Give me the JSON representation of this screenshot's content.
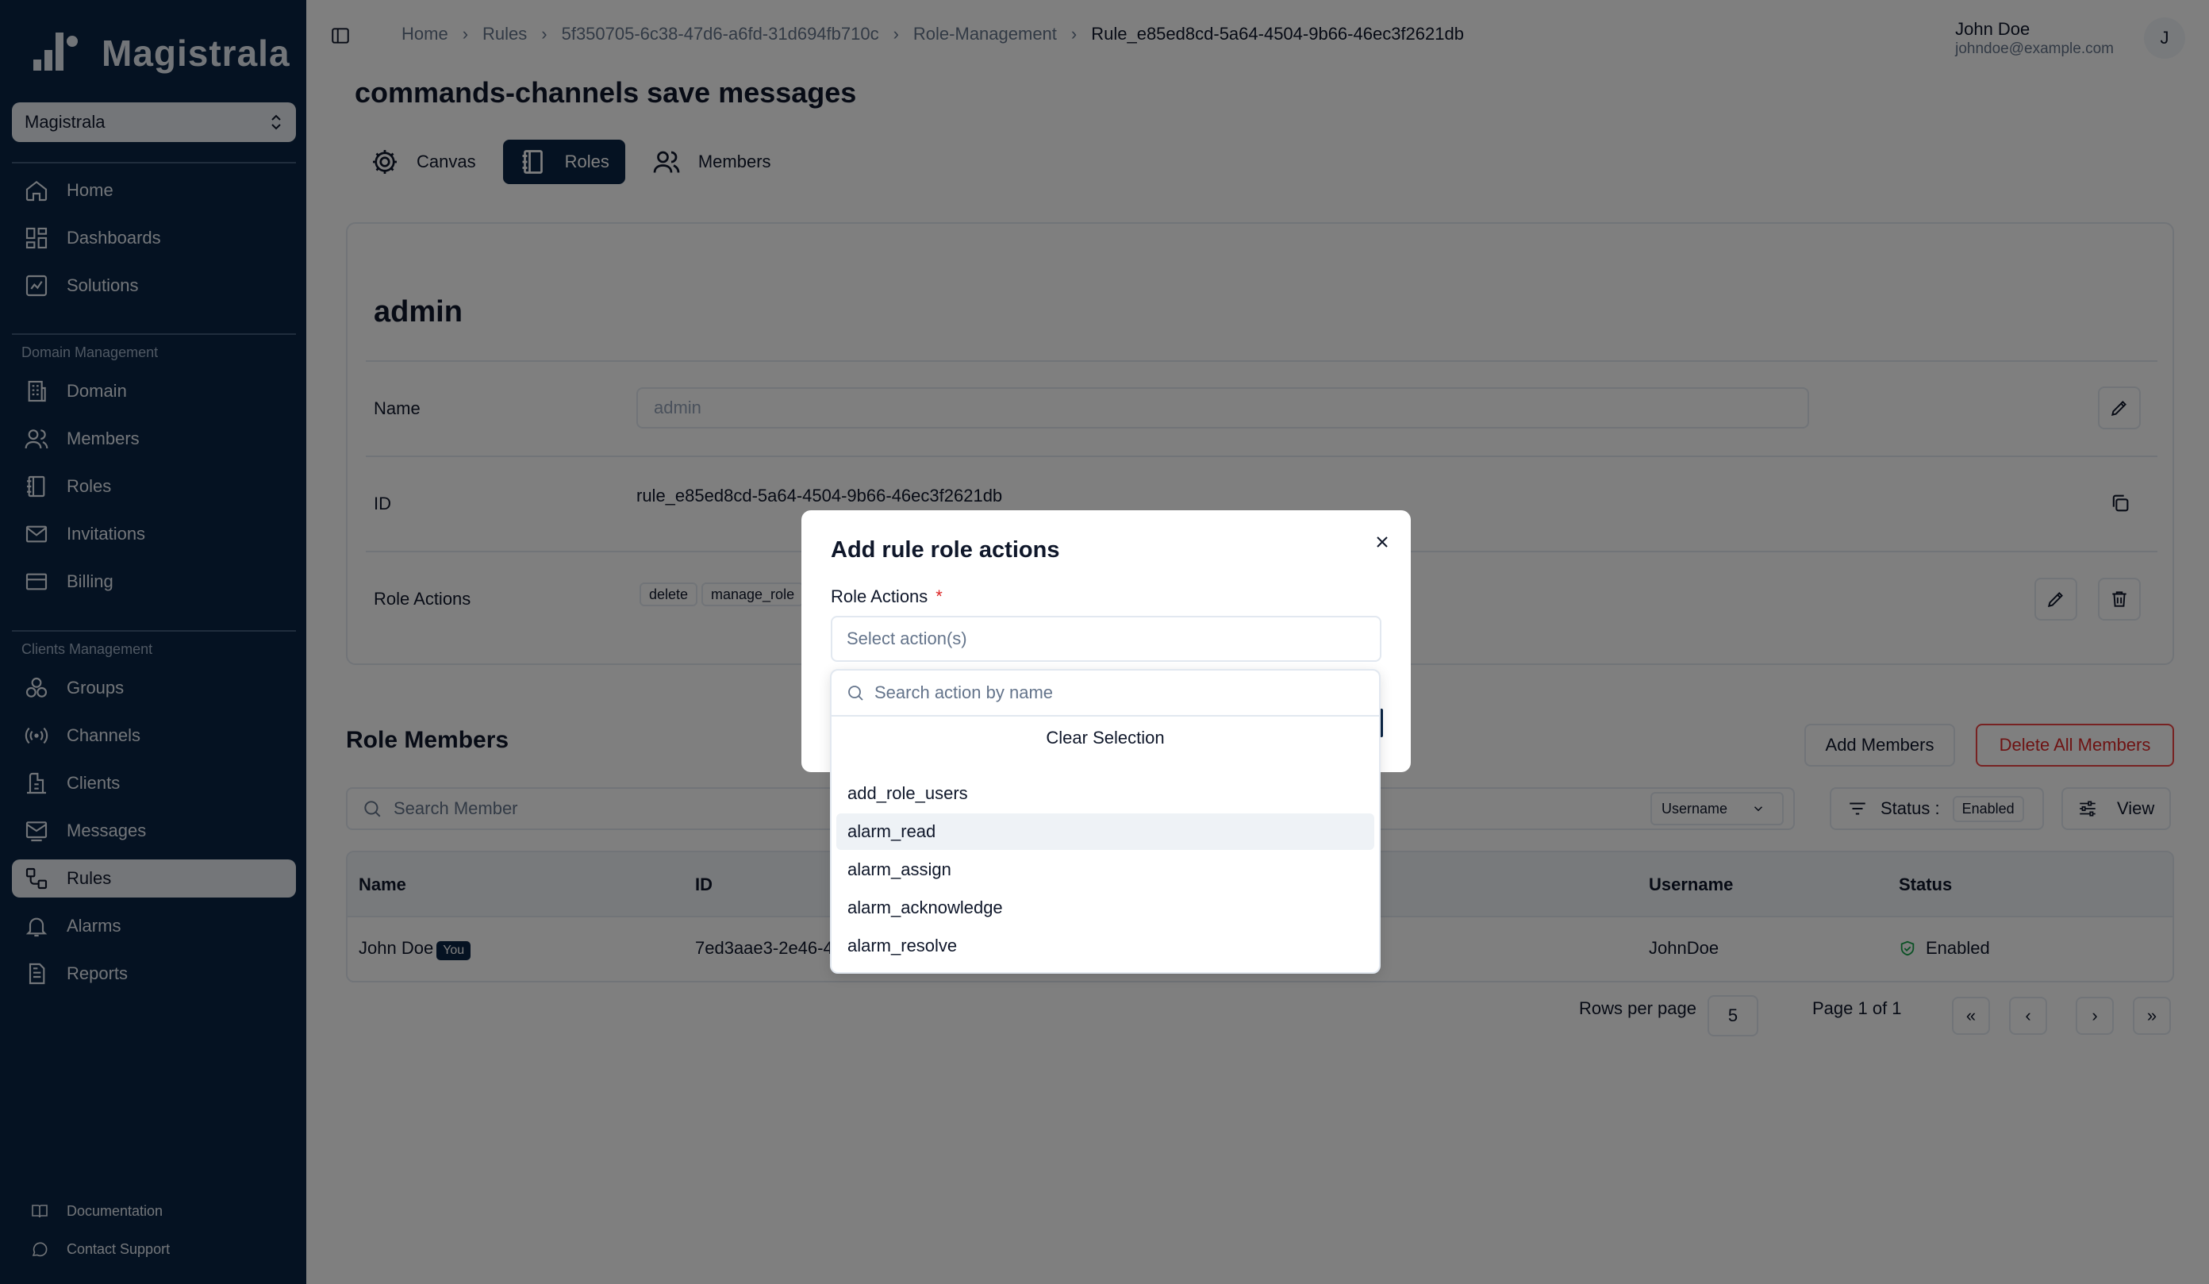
{
  "sidebar": {
    "brand": "Magistrala",
    "domain_select": "Magistrala",
    "nav_main": [
      {
        "label": "Home",
        "icon": "home-icon"
      },
      {
        "label": "Dashboards",
        "icon": "dashboard-icon"
      },
      {
        "label": "Solutions",
        "icon": "solutions-icon"
      }
    ],
    "section_domain": "Domain Management",
    "nav_domain": [
      {
        "label": "Domain",
        "icon": "building-icon"
      },
      {
        "label": "Members",
        "icon": "users-icon"
      },
      {
        "label": "Roles",
        "icon": "notebook-icon"
      },
      {
        "label": "Invitations",
        "icon": "mail-icon"
      },
      {
        "label": "Billing",
        "icon": "card-icon"
      }
    ],
    "section_clients": "Clients Management",
    "nav_clients": [
      {
        "label": "Groups",
        "icon": "groups-icon"
      },
      {
        "label": "Channels",
        "icon": "radio-icon"
      },
      {
        "label": "Clients",
        "icon": "clients-icon"
      },
      {
        "label": "Messages",
        "icon": "messages-icon"
      },
      {
        "label": "Rules",
        "icon": "rules-icon",
        "active": true
      },
      {
        "label": "Alarms",
        "icon": "bell-icon"
      },
      {
        "label": "Reports",
        "icon": "report-icon"
      }
    ],
    "footer": [
      {
        "label": "Documentation",
        "icon": "book-icon"
      },
      {
        "label": "Contact Support",
        "icon": "chat-icon"
      }
    ]
  },
  "breadcrumb": [
    "Home",
    "Rules",
    "5f350705-6c38-47d6-a6fd-31d694fb710c",
    "Role-Management",
    "Rule_e85ed8cd-5a64-4504-9b66-46ec3f2621db"
  ],
  "user": {
    "name": "John Doe",
    "email": "johndoe@example.com",
    "initial": "J"
  },
  "page_title": "commands-channels save messages",
  "tabs": [
    "Canvas",
    "Roles",
    "Members"
  ],
  "role": {
    "name": "admin",
    "name_label": "Name",
    "name_value": "admin",
    "id_label": "ID",
    "id_value": "rule_e85ed8cd-5a64-4504-9b66-46ec3f2621db",
    "actions_label": "Role Actions",
    "actions": [
      "delete",
      "manage_role"
    ]
  },
  "members": {
    "title": "Role Members",
    "add_button": "Add Members",
    "delete_all_button": "Delete All Members",
    "search_placeholder": "Search Member",
    "search_by": "Username",
    "status_label": "Status :",
    "status_value": "Enabled",
    "view_label": "View",
    "columns": [
      "Name",
      "ID",
      "Username",
      "Status"
    ],
    "rows": [
      {
        "name": "John Doe",
        "badge": "You",
        "id": "7ed3aae3-2e46-4",
        "username": "JohnDoe",
        "status": "Enabled"
      }
    ],
    "rows_per_page_label": "Rows per page",
    "rows_per_page": "5",
    "page_info": "Page 1 of 1"
  },
  "dialog": {
    "title": "Add rule role actions",
    "field_label": "Role Actions",
    "required_mark": "*",
    "select_placeholder": "Select action(s)",
    "search_placeholder": "Search action by name",
    "clear_label": "Clear Selection",
    "options": [
      "add_role_users",
      "alarm_read",
      "alarm_assign",
      "alarm_acknowledge",
      "alarm_resolve"
    ],
    "highlighted": "alarm_read"
  }
}
